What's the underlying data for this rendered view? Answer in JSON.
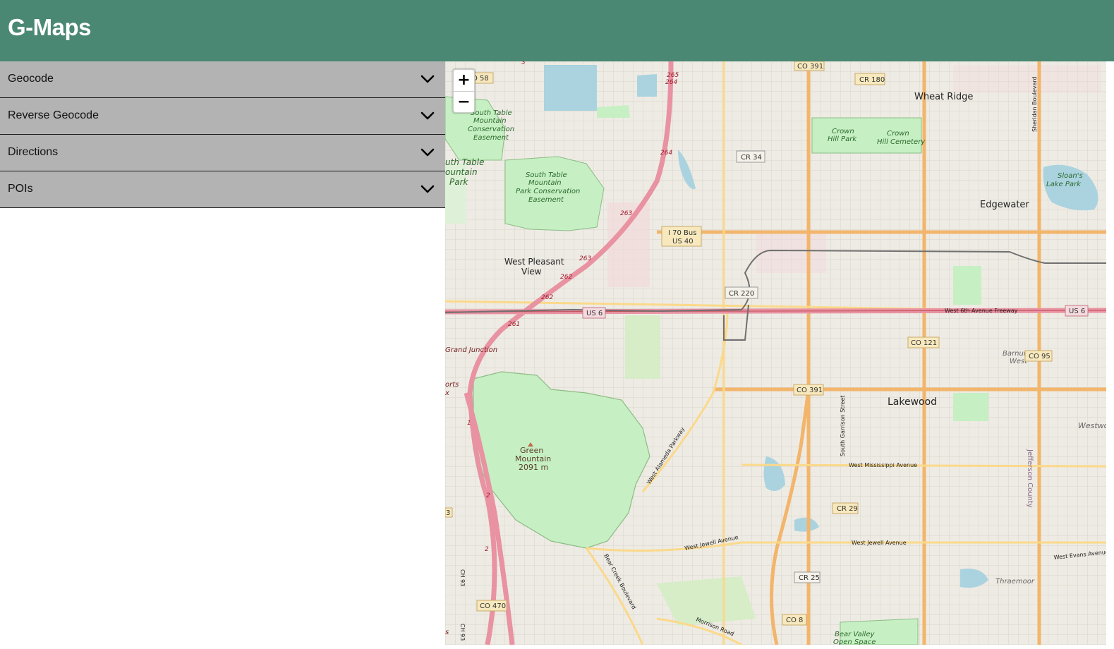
{
  "header": {
    "title": "G-Maps",
    "color": "#4a8874"
  },
  "sidebar": {
    "panels": [
      {
        "label": "Geocode",
        "icon": "chevron-down-icon"
      },
      {
        "label": "Reverse Geocode",
        "icon": "chevron-down-icon"
      },
      {
        "label": "Directions",
        "icon": "chevron-down-icon"
      },
      {
        "label": "POIs",
        "icon": "chevron-down-icon"
      }
    ]
  },
  "map": {
    "zoom_in": "+",
    "zoom_out": "−",
    "places": {
      "wheat_ridge": "Wheat Ridge",
      "edgewater": "Edgewater",
      "lakewood": "Lakewood",
      "west_pleasant_view_1": "West Pleasant",
      "west_pleasant_view_2": "View",
      "barnum_west_1": "Barnum",
      "barnum_west_2": "West",
      "westwood": "Westwo",
      "thraemoor": "Thraemoor",
      "grand_junction": "Grand Junction",
      "green_mountain_1": "Green",
      "green_mountain_2": "Mountain",
      "green_mountain_3": "2091 m"
    },
    "parks": {
      "crown_hill_park_1": "Crown",
      "crown_hill_park_2": "Hill Park",
      "crown_hill_cemetery_1": "Crown",
      "crown_hill_cemetery_2": "Hill Cemetery",
      "sloans_lake_1": "Sloan's",
      "sloans_lake_2": "Lake Park",
      "stm_ease_1": "South Table",
      "stm_ease_2": "Mountain",
      "stm_ease_3": "Conservation",
      "stm_ease_4": "Easement",
      "stm_park_1": "uth Table",
      "stm_park_2": "ountain",
      "stm_park_3": "Park",
      "stm_pce_1": "South Table",
      "stm_pce_2": "Mountain",
      "stm_pce_3": "Park Conservation",
      "stm_pce_4": "Easement",
      "bear_valley_1": "Bear Valley",
      "bear_valley_2": "Open Space"
    },
    "shields": {
      "co391_top": "CO 391",
      "cr180": "CR 180",
      "co58": "O 58",
      "cr34": "CR 34",
      "i70bus_1": "I 70 Bus",
      "i70bus_2": "US 40",
      "cr220": "CR 220",
      "us6_left": "US 6",
      "us6_right": "US 6",
      "co121": "CO 121",
      "co95": "CO 95",
      "co391_mid": "CO 391",
      "cr29": "CR 29",
      "cr25": "CR 25",
      "co470": "CO 470",
      "co8": "CO 8",
      "ex3": "3"
    },
    "roads": {
      "sixth_ave": "West 6th Avenue Freeway",
      "mississippi": "West Mississippi Avenue",
      "jewell_1": "West Jewell Avenue",
      "jewell_2": "West Jewell Avenue",
      "evans": "West Evans Avenue",
      "alameda": "West Alameda Parkway",
      "bear_creek": "Bear Creek Boulevard",
      "morrison": "Morrison Road",
      "garrison": "South Garrison Street",
      "sheridan": "Sheridan Boulevard",
      "jefferson": "Jefferson County",
      "ch93_1": "CH 93",
      "ch93_2": "CH 93"
    },
    "exits": [
      "265",
      "264",
      "264",
      "263",
      "263",
      "262",
      "262",
      "261",
      "1",
      "2",
      "2",
      "3"
    ],
    "edges": {
      "orts": "orts",
      "x": "x",
      "s": "s"
    }
  }
}
